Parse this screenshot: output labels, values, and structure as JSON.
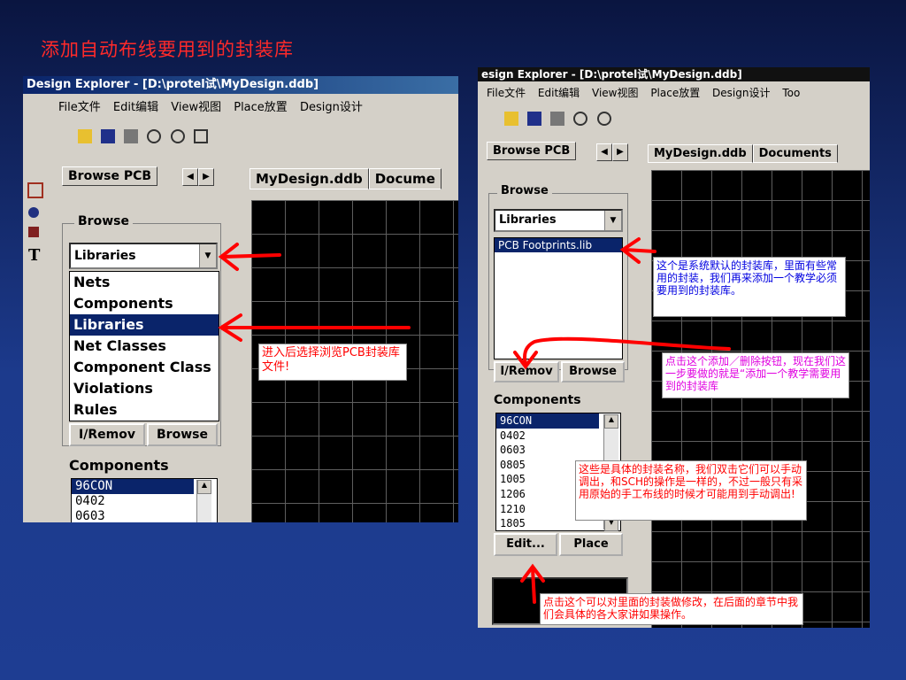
{
  "slide": {
    "title": "添加自动布线要用到的封装库",
    "colors": {
      "title": "#ff2a2a",
      "arrow": "#ff0000",
      "selection": "#0a246a"
    }
  },
  "left": {
    "titlebar": "Design Explorer - [D:\\protel试\\MyDesign.ddb]",
    "menu": [
      "File文件",
      "Edit编辑",
      "View视图",
      "Place放置",
      "Design设计"
    ],
    "tab": "Browse PCB",
    "group_label": "Browse",
    "combo_value": "Libraries",
    "dropdown": [
      "Nets",
      "Components",
      "Libraries",
      "Net Classes",
      "Component Class",
      "Violations",
      "Rules"
    ],
    "selected_index": 2,
    "button_add": "I/Remov",
    "button_browse": "Browse",
    "components_label": "Components",
    "components": [
      "96CON",
      "0402",
      "0603"
    ],
    "doc_tabs": [
      "MyDesign.ddb",
      "Docume"
    ],
    "note": "进入后选择浏览PCB封装库文件!"
  },
  "right": {
    "titlebar": "esign Explorer - [D:\\protel试\\MyDesign.ddb]",
    "menu": [
      "File文件",
      "Edit编辑",
      "View视图",
      "Place放置",
      "Design设计",
      "Too"
    ],
    "tab": "Browse PCB",
    "group_label": "Browse",
    "combo_value": "Libraries",
    "library": "PCB Footprints.lib",
    "button_add": "I/Remov",
    "button_browse": "Browse",
    "components_label": "Components",
    "components": [
      "96CON",
      "0402",
      "0603",
      "0805",
      "1005",
      "1206",
      "1210",
      "1805"
    ],
    "button_edit": "Edit...",
    "button_place": "Place",
    "doc_tabs": [
      "MyDesign.ddb",
      "Documents"
    ],
    "note_library": "这个是系统默认的封装库，里面有些常用的封装，我们再来添加一个教学必须要用到的封装库。",
    "note_button": "点击这个添加／删除按钮，现在我们这一步要做的就是“添加一个教学需要用到的封装库",
    "note_components": "这些是具体的封装名称，我们双击它们可以手动调出，和SCH的操作是一样的，不过一般只有采用原始的手工布线的时候才可能用到手动调出!",
    "note_edit": "点击这个可以对里面的封装做修改，在后面的章节中我们会具体的各大家讲如果操作。"
  }
}
